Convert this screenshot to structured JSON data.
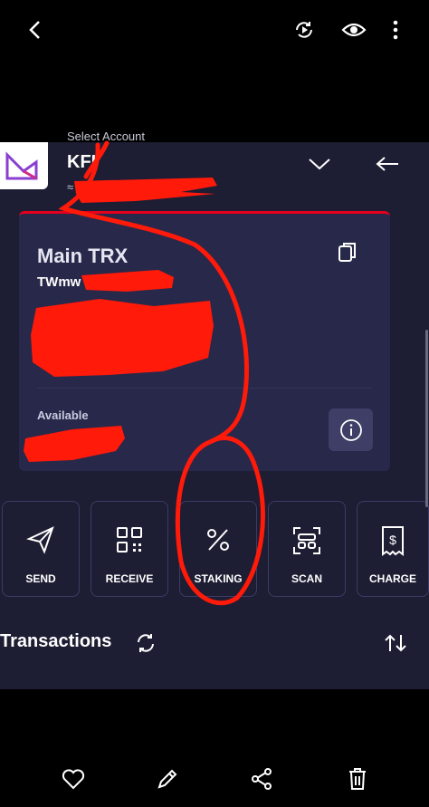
{
  "viewer": {
    "top_icons": [
      "back-icon",
      "rotate-icon",
      "eye-icon",
      "more-icon"
    ],
    "bottom_icons": [
      "heart-icon",
      "pencil-icon",
      "share-icon",
      "trash-icon"
    ]
  },
  "account": {
    "label": "Select Account",
    "code": "KFI",
    "sub": "≈"
  },
  "card": {
    "title": "Main TRX",
    "address": "TWmw",
    "available_label": "Available"
  },
  "actions": [
    {
      "label": "SEND",
      "icon": "send-icon"
    },
    {
      "label": "RECEIVE",
      "icon": "qr-icon"
    },
    {
      "label": "STAKING",
      "icon": "percent-icon"
    },
    {
      "label": "SCAN",
      "icon": "scan-icon"
    },
    {
      "label": "CHARGE",
      "icon": "receipt-icon"
    }
  ],
  "transactions": {
    "title": "Transactions"
  },
  "colors": {
    "app_bg": "#1d1d33",
    "card_bg": "#28284a",
    "accent_red": "#e4001c",
    "scribble": "#ff1a0a"
  }
}
